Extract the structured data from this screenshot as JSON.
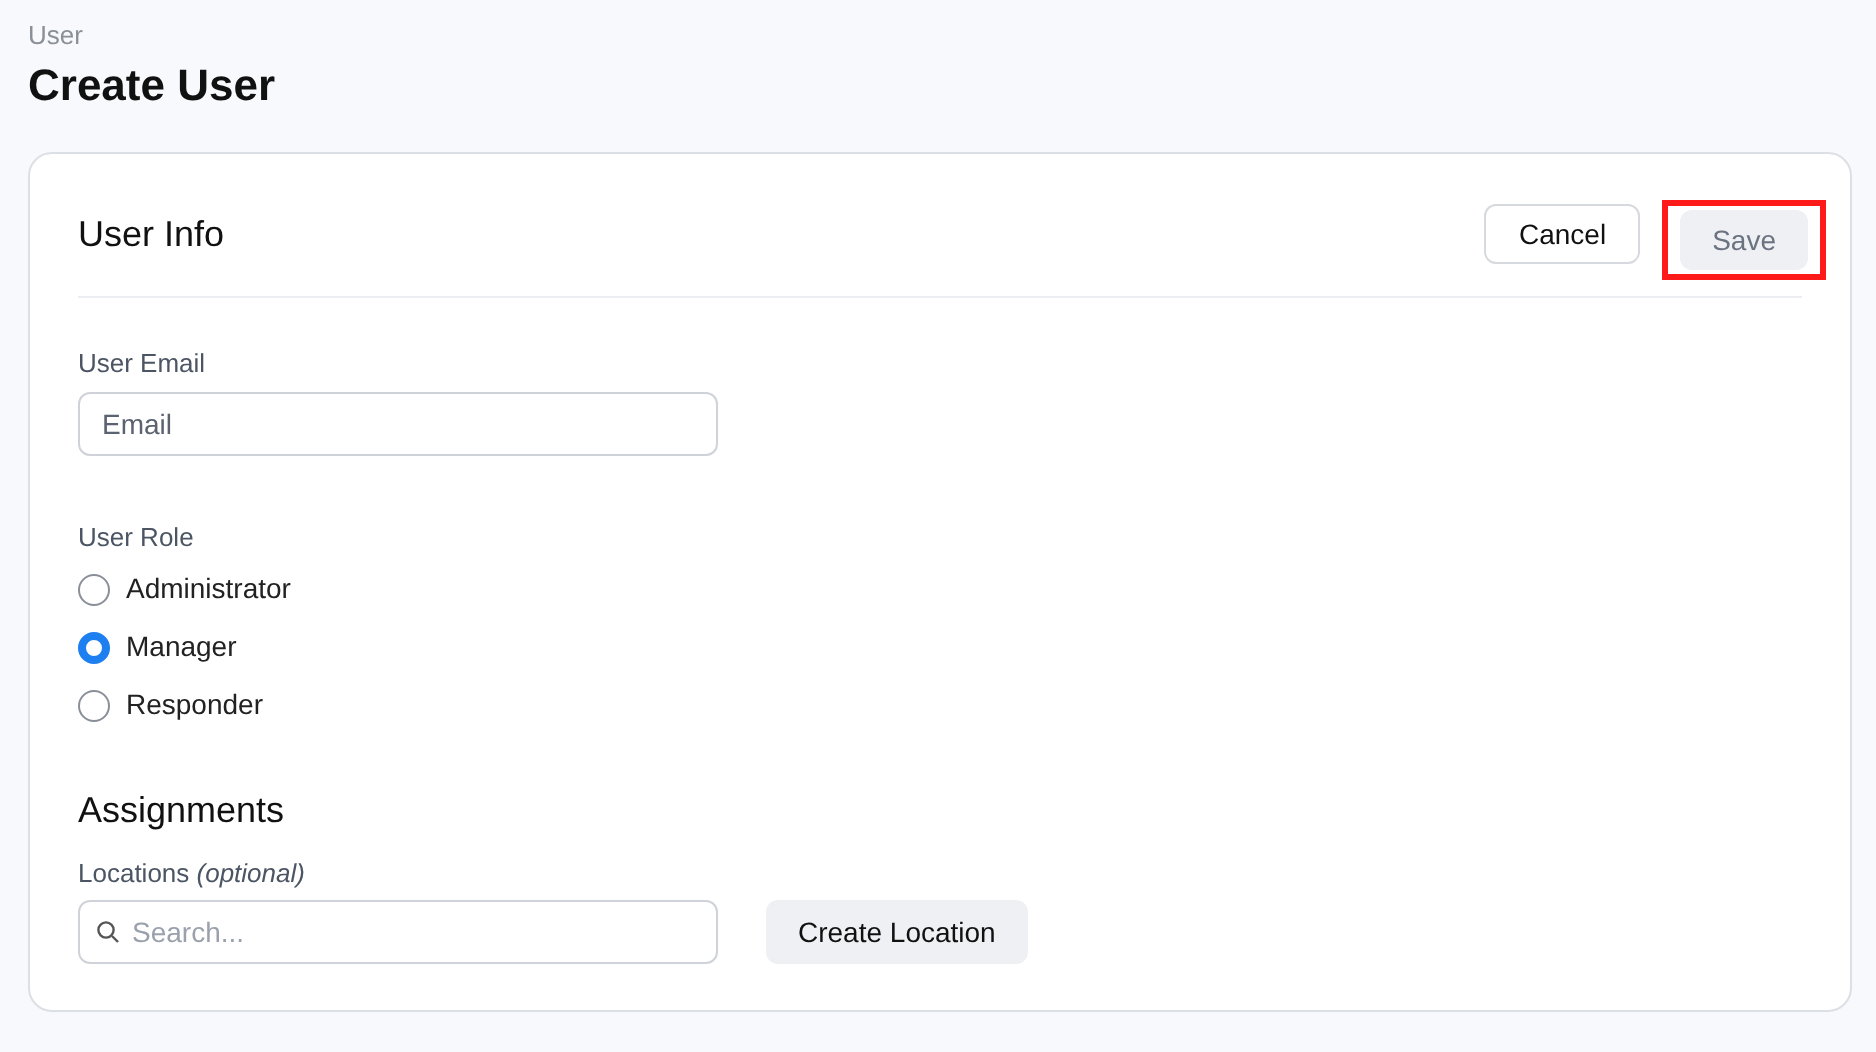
{
  "breadcrumb": "User",
  "title": "Create User",
  "card": {
    "heading": "User Info",
    "actions": [
      {
        "kind": "secondary",
        "label": "Cancel",
        "disabled": false,
        "highlighted": false
      },
      {
        "kind": "primary",
        "label": "Save",
        "disabled": true,
        "highlighted": true
      }
    ],
    "email": {
      "label": "User Email",
      "placeholder": "Email"
    },
    "role": {
      "label": "User Role",
      "options": [
        {
          "label": "Administrator",
          "selected": false
        },
        {
          "label": "Manager",
          "selected": true
        },
        {
          "label": "Responder",
          "selected": false
        }
      ]
    },
    "assignments": {
      "heading": "Assignments",
      "label": "Locations *(optional)*",
      "search": {
        "placeholder": "Search..."
      },
      "button": "Create Location"
    }
  }
}
